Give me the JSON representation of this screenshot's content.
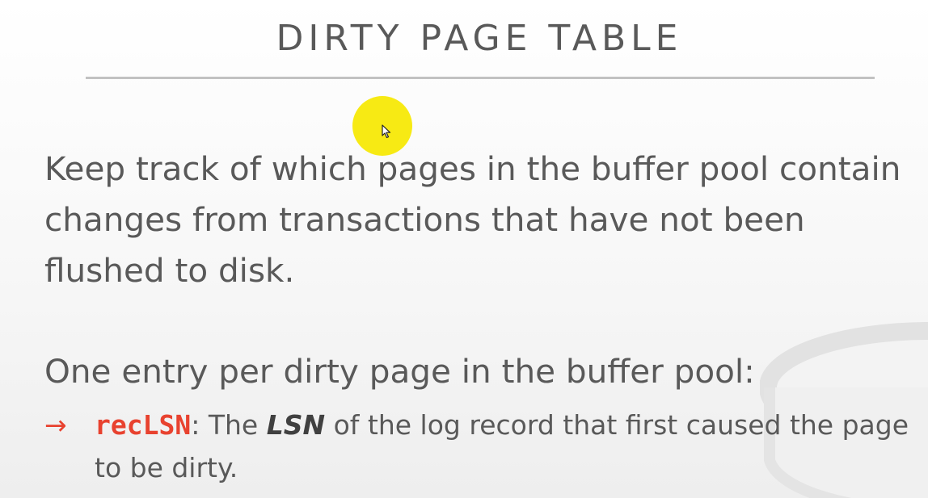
{
  "slide": {
    "title": "DIRTY PAGE TABLE",
    "paragraph": "Keep track of which pages in the buffer pool contain changes from transactions that have not been flushed to disk.",
    "entry_intro": "One entry per dirty page in the buffer pool:",
    "bullet": {
      "arrow": "→",
      "term": "recLSN",
      "text_before": ": The ",
      "emphasis": "LSN",
      "text_after": " of the log record that first caused the page to be dirty."
    }
  },
  "colors": {
    "text": "#595959",
    "accent": "#e8422f",
    "pointer_highlight": "#f7ea14"
  },
  "icons": {
    "pointer": "mouse-cursor-icon"
  }
}
